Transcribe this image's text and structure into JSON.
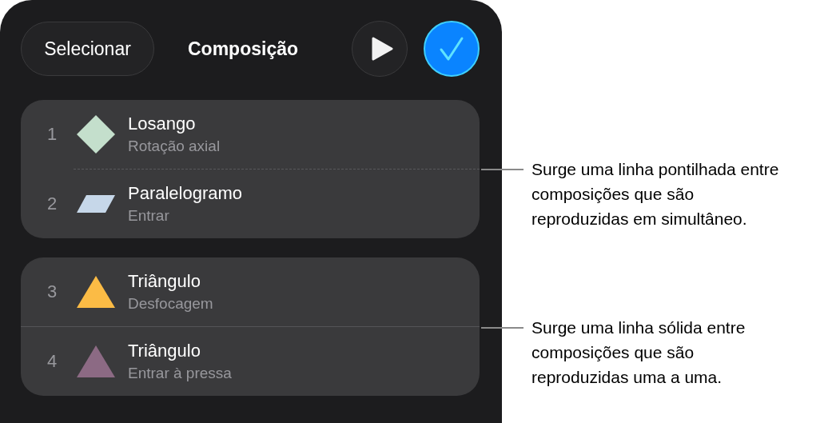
{
  "header": {
    "select_button": "Selecionar",
    "title": "Composição"
  },
  "groups": [
    {
      "kind": "dashed",
      "items": [
        {
          "number": "1",
          "title": "Losango",
          "subtitle": "Rotação axial",
          "kind": "diamond",
          "color": "#c4dfcc"
        },
        {
          "number": "2",
          "title": "Paralelogramo",
          "subtitle": "Entrar",
          "kind": "parallelogram",
          "color": "#c6d7e9"
        }
      ]
    },
    {
      "kind": "solid",
      "items": [
        {
          "number": "3",
          "title": "Triângulo",
          "subtitle": "Desfocagem",
          "kind": "triangle",
          "color": "#fbbb45"
        },
        {
          "number": "4",
          "title": "Triângulo",
          "subtitle": "Entrar à pressa",
          "kind": "triangle",
          "color": "#8c6a84"
        }
      ]
    }
  ],
  "callouts": [
    {
      "text": "Surge uma linha pontilhada entre composições que são reproduzidas em simultâneo."
    },
    {
      "text": "Surge uma linha sólida entre composições que são reproduzidas uma a uma."
    }
  ]
}
